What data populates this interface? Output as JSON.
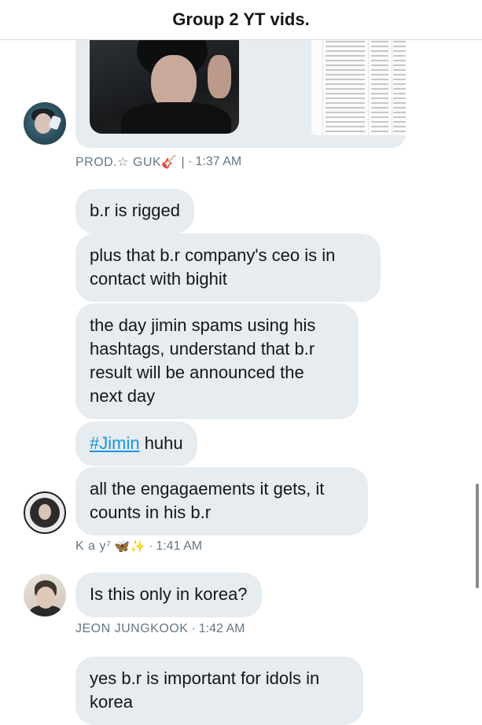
{
  "header": {
    "title": "Group 2 YT vids."
  },
  "messages": {
    "group1_meta": {
      "name": "PROD.☆ GUK🎸 |",
      "sep": "·",
      "time": "1:37 AM"
    },
    "m1": "b.r is rigged",
    "m2": {
      "l1": "plus that b.r company's ceo is in",
      "l2": "contact with bighit"
    },
    "m3": {
      "l1": "the day jimin spams using his",
      "l2": "hashtags, understand that b.r",
      "l3": "result will be announced the",
      "l4": "next day"
    },
    "m4": {
      "hashtag": "#Jimin",
      "rest": " huhu"
    },
    "m5": {
      "l1": "all the engagaements it gets, it",
      "l2": "counts in his b.r"
    },
    "group2_meta": {
      "name": "K a y⁷",
      "emoji": "🦋✨",
      "sep": "·",
      "time": "1:41 AM"
    },
    "m6": "Is this only in korea?",
    "group3_meta": {
      "name": "JEON JUNGKOOK",
      "sep": "·",
      "time": "1:42 AM"
    },
    "m7": {
      "l1": "yes b.r is important for idols in",
      "l2": "korea"
    }
  },
  "icons": {
    "avatar1": "user-avatar-photo",
    "avatar2": "user-avatar-photo",
    "avatar3": "user-avatar-photo"
  },
  "colors": {
    "bubble": "#e6ecf0",
    "meta": "#657786",
    "hashtag": "#1b95e0"
  }
}
